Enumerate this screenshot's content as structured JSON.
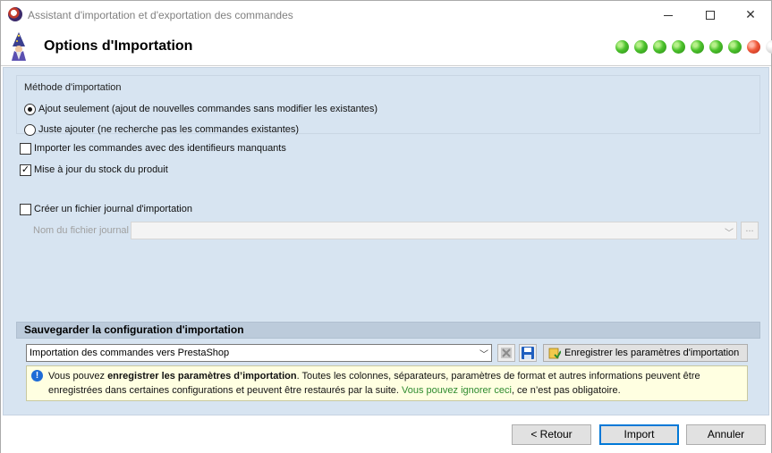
{
  "window": {
    "title": "Assistant d'importation et d'exportation des commandes"
  },
  "header": {
    "title": "Options d'Importation",
    "progress_steps": [
      "green",
      "green",
      "green",
      "green",
      "green",
      "green",
      "green",
      "red",
      "gray"
    ]
  },
  "method": {
    "label": "Méthode d'importation",
    "options": [
      {
        "label": "Ajout seulement (ajout de nouvelles commandes sans modifier les existantes)",
        "checked": true
      },
      {
        "label": "Juste ajouter (ne recherche pas les commandes existantes)",
        "checked": false
      }
    ]
  },
  "options": {
    "missing_ids": {
      "label": "Importer les commandes avec des identifieurs manquants",
      "checked": false
    },
    "update_stock": {
      "label": "Mise à jour du stock du produit",
      "checked": true
    },
    "create_log": {
      "label": "Créer un fichier journal d'importation",
      "checked": false
    }
  },
  "log_file": {
    "label": "Nom du fichier journal",
    "value": "",
    "browse_label": "..."
  },
  "save_config": {
    "header": "Sauvegarder la configuration d'importation",
    "config_value": "Importation des commandes vers PrestaShop",
    "register_button": "Enregistrer les paramètres d'importation",
    "info": {
      "prefix": "Vous pouvez ",
      "bold": "enregistrer les paramètres d’importation",
      "middle": ". Toutes les colonnes, séparateurs, paramètres de format et autres informations peuvent être enregistrées dans certaines configurations et peuvent être restaurés par la suite. ",
      "green": "Vous pouvez ignorer ceci",
      "suffix": ", ce n’est pas obligatoire."
    }
  },
  "footer": {
    "back": "< Retour",
    "import": "Import",
    "cancel": "Annuler"
  }
}
